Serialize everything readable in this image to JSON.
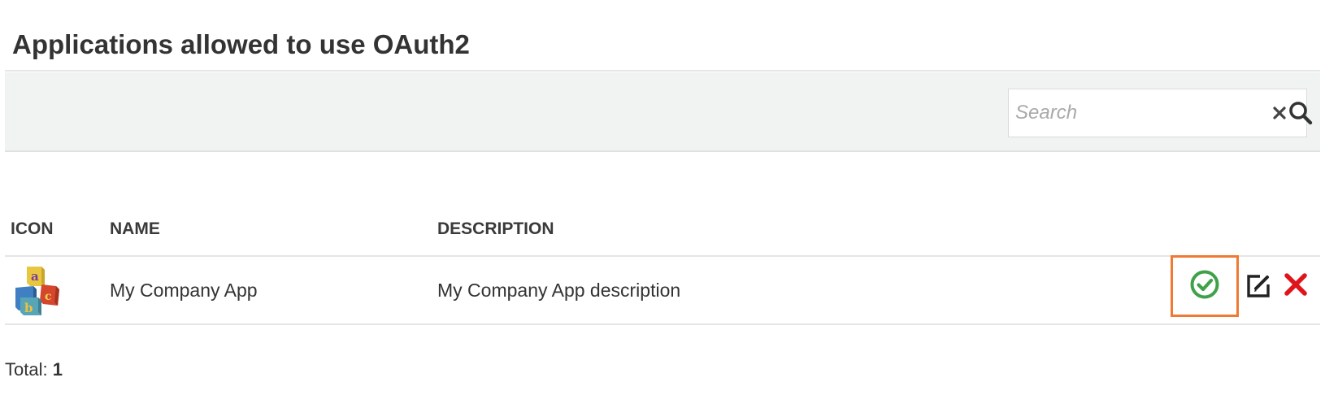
{
  "page": {
    "title": "Applications allowed to use OAuth2"
  },
  "search": {
    "placeholder": "Search",
    "value": ""
  },
  "table": {
    "headers": {
      "icon": "ICON",
      "name": "NAME",
      "description": "DESCRIPTION"
    },
    "rows": [
      {
        "icon": "abc-blocks-icon",
        "name": "My Company App",
        "description": "My Company App description",
        "actions": [
          "check-circle-icon",
          "edit-icon",
          "delete-x-icon"
        ]
      }
    ]
  },
  "footer": {
    "total_label": "Total:",
    "total_value": "1"
  },
  "colors": {
    "approve_green": "#3fa24b",
    "delete_red": "#e0151c",
    "highlight_orange": "#ef7a34",
    "toolbar_bg": "#f1f2f2"
  }
}
